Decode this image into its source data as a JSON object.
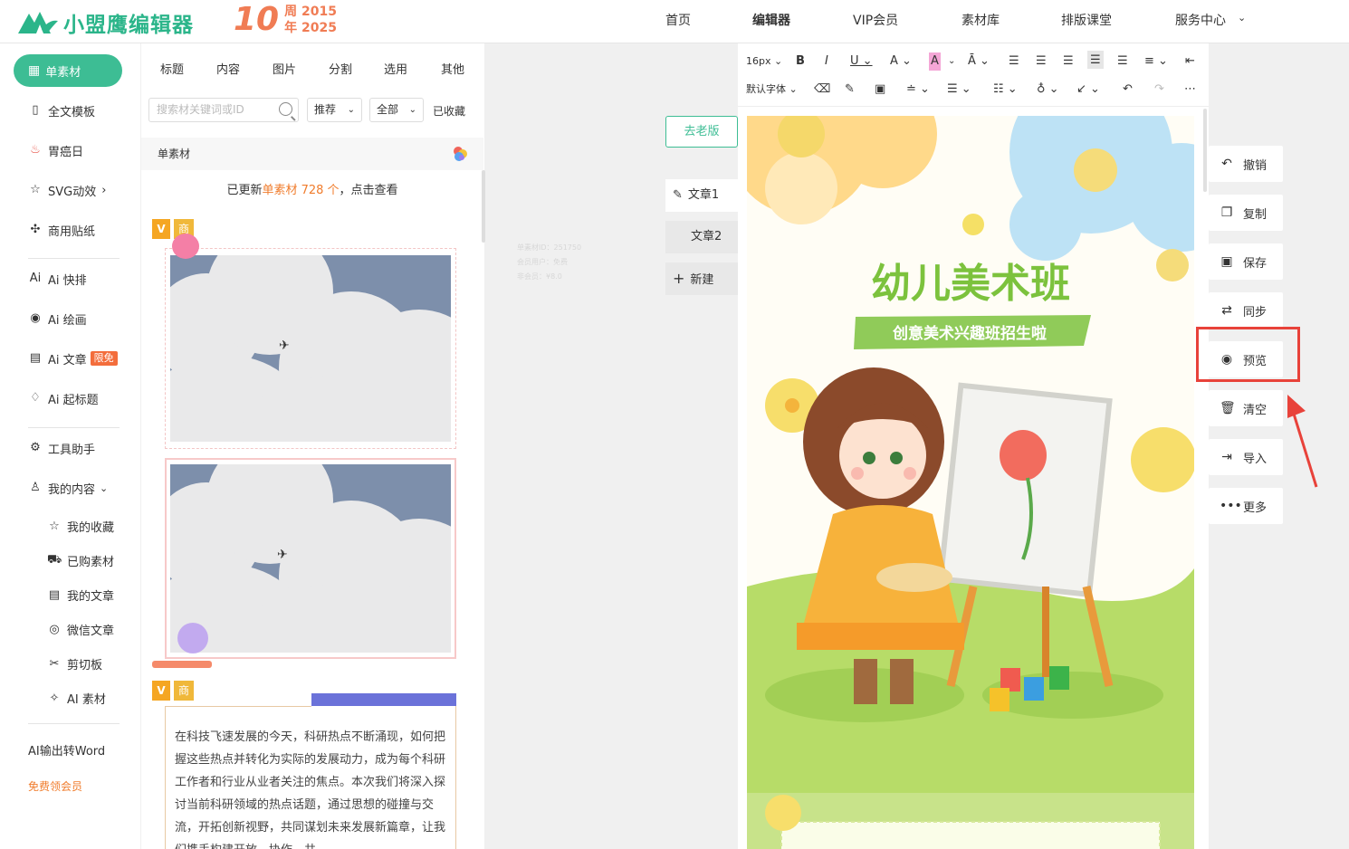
{
  "header": {
    "logo_text": "小盟鹰编辑器",
    "anniversary_num": "10",
    "anniversary_line1": "周 2015",
    "anniversary_line2": "年 2025",
    "nav": [
      "首页",
      "编辑器",
      "VIP会员",
      "素材库",
      "排版课堂",
      "服务中心"
    ],
    "nav_active": "编辑器",
    "service_chevron": "⌄"
  },
  "sidebar": {
    "active": "单素材",
    "items": [
      "全文模板",
      "胃癌日",
      "SVG动效",
      "商用贴纸",
      "Ai 快排",
      "Ai 绘画",
      "Ai 文章",
      "Ai 起标题",
      "工具助手",
      "我的内容"
    ],
    "ai_article_badge": "限免",
    "svg_chevron": "›",
    "my_chevron": "⌄",
    "sub_items": [
      "我的收藏",
      "已购素材",
      "我的文章",
      "微信文章",
      "剪切板",
      "AI 素材"
    ],
    "word_convert": "AI输出转Word",
    "free_vip": "免费领会员"
  },
  "panel": {
    "tabs": [
      "标题",
      "内容",
      "图片",
      "分割",
      "选用",
      "其他"
    ],
    "search_placeholder": "搜索材关键词或ID",
    "filter_recommend": "推荐",
    "filter_all": "全部",
    "collected": "已收藏",
    "section": "单素材",
    "updated_prefix": "已更新",
    "updated_highlight": "单素材 728 个",
    "updated_suffix": "，点击查看",
    "tag_v": "V",
    "tag_shang": "商",
    "article_text": "在科技飞速发展的今天，科研热点不断涌现，如何把握这些热点并转化为实际的发展动力，成为每个科研工作者和行业从业者关注的焦点。本次我们将深入探讨当前科研领域的热点话题，通过思想的碰撞与交流，开拓创新视野，共同谋划未来发展新篇章，让我们携手构建开放、协作、共"
  },
  "canvas": {
    "old_version": "去老版",
    "doc_tabs": [
      "文章1",
      "文章2"
    ],
    "new_doc": "新建",
    "ghost_lines": [
      "单素材ID：251750",
      "会员用户：免费",
      "非会员：¥8.0"
    ]
  },
  "editor": {
    "font_size": "16px",
    "font_family": "默认字体",
    "poster_title": "幼儿美术班",
    "poster_subtitle": "创意美术兴趣班招生啦"
  },
  "actions": [
    "撤销",
    "复制",
    "保存",
    "同步",
    "预览",
    "清空",
    "导入",
    "更多"
  ],
  "colors": {
    "brand": "#3dbd94",
    "accent": "#f07c2c",
    "highlight": "#e8423a"
  }
}
